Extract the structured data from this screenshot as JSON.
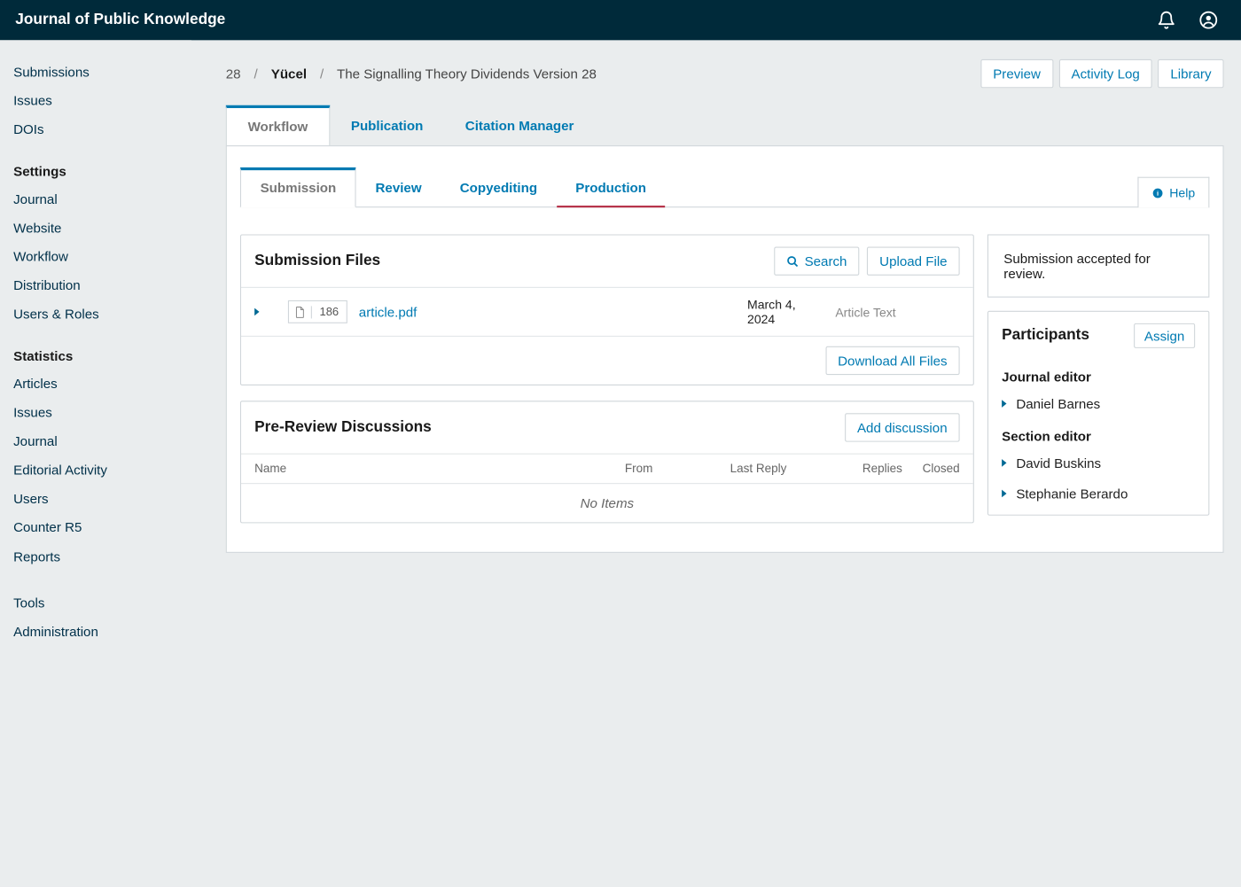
{
  "app": {
    "title": "Journal of Public Knowledge"
  },
  "sidebar": {
    "items": [
      {
        "label": "Submissions"
      },
      {
        "label": "Issues"
      },
      {
        "label": "DOIs"
      }
    ],
    "settings_header": "Settings",
    "settings": [
      {
        "label": "Journal"
      },
      {
        "label": "Website"
      },
      {
        "label": "Workflow"
      },
      {
        "label": "Distribution"
      },
      {
        "label": "Users & Roles"
      }
    ],
    "stats_header": "Statistics",
    "stats": [
      {
        "label": "Articles"
      },
      {
        "label": "Issues"
      },
      {
        "label": "Journal"
      },
      {
        "label": "Editorial Activity"
      },
      {
        "label": "Users"
      },
      {
        "label": "Counter R5"
      },
      {
        "label": "Reports"
      }
    ],
    "bottom": [
      {
        "label": "Tools"
      },
      {
        "label": "Administration"
      }
    ]
  },
  "crumbs": {
    "id": "28",
    "author": "Yücel",
    "title": "The Signalling Theory Dividends Version 28"
  },
  "actions": {
    "preview": "Preview",
    "activity_log": "Activity Log",
    "library": "Library"
  },
  "outer_tabs": {
    "workflow": "Workflow",
    "publication": "Publication",
    "citation": "Citation Manager"
  },
  "workflow_tabs": {
    "submission": "Submission",
    "review": "Review",
    "copyediting": "Copyediting",
    "production": "Production",
    "help": "Help"
  },
  "files_panel": {
    "title": "Submission Files",
    "search": "Search",
    "upload": "Upload File",
    "download_all": "Download All Files",
    "row": {
      "id": "186",
      "name": "article.pdf",
      "date": "March 4, 2024",
      "kind": "Article Text"
    }
  },
  "discussions": {
    "title": "Pre-Review Discussions",
    "add": "Add discussion",
    "cols": {
      "name": "Name",
      "from": "From",
      "last": "Last Reply",
      "replies": "Replies",
      "closed": "Closed"
    },
    "empty": "No Items"
  },
  "status": {
    "text": "Submission accepted for review."
  },
  "participants": {
    "title": "Participants",
    "assign": "Assign",
    "roles": [
      {
        "role": "Journal editor",
        "people": [
          "Daniel Barnes"
        ]
      },
      {
        "role": "Section editor",
        "people": [
          "David Buskins",
          "Stephanie Berardo"
        ]
      }
    ]
  },
  "icons": {
    "bell": "bell-icon",
    "user": "user-circle-icon",
    "info": "info-circle-icon",
    "search": "search-icon",
    "doc": "file-icon"
  }
}
